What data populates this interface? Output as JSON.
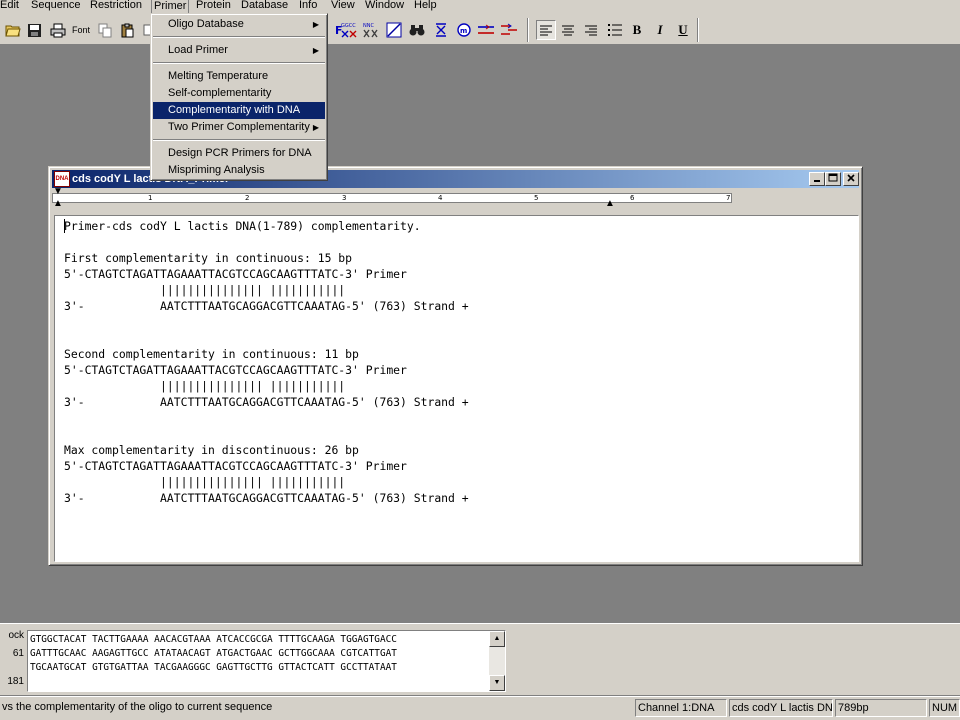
{
  "menubar": {
    "items": [
      "Edit",
      "Sequence",
      "Restriction",
      "Primer",
      "Protein",
      "Database",
      "Info",
      "View",
      "Window",
      "Help"
    ],
    "active": "Primer"
  },
  "toolbar": {
    "font_label": "Font",
    "bold_label": "B",
    "italic_label": "I",
    "underline_label": "U"
  },
  "primer_menu": {
    "items": [
      {
        "label": "Oligo Database",
        "submenu": true
      },
      {
        "label": "Load Primer",
        "submenu": true
      },
      {
        "label": "Melting Temperature",
        "submenu": false
      },
      {
        "label": "Self-complementarity",
        "submenu": false
      },
      {
        "label": "Complementarity with DNA",
        "submenu": false,
        "highlighted": true
      },
      {
        "label": "Two Primer Complementarity",
        "submenu": true
      },
      {
        "label": "Design PCR Primers for DNA",
        "submenu": false
      },
      {
        "label": "Mispriming Analysis",
        "submenu": false
      }
    ]
  },
  "window": {
    "title": "cds codY L lactis DNA_Primer",
    "icon_text": "DNA"
  },
  "ruler": {
    "numbers": [
      "1",
      "2",
      "3",
      "4",
      "5",
      "6",
      "7"
    ]
  },
  "result_text": {
    "heading": "Primer-cds codY L lactis DNA(1-789) complementarity.",
    "sections": [
      {
        "title": "First complementarity in continuous: 15 bp",
        "primer_line": "5'-CTAGTCTAGATTAGAAATTACGTCCAGCAAGTTTATC-3' Primer",
        "match_line": "              ||||||||||||||| |||||||||||",
        "target_line": "3'-           AATCTTTAATGCAGGACGTTCAAATAG-5' (763) Strand +"
      },
      {
        "title": "Second complementarity in continuous: 11 bp",
        "primer_line": "5'-CTAGTCTAGATTAGAAATTACGTCCAGCAAGTTTATC-3' Primer",
        "match_line": "              ||||||||||||||| |||||||||||",
        "target_line": "3'-           AATCTTTAATGCAGGACGTTCAAATAG-5' (763) Strand +"
      },
      {
        "title": "Max complementarity in discontinuous: 26 bp",
        "primer_line": "5'-CTAGTCTAGATTAGAAATTACGTCCAGCAAGTTTATC-3' Primer",
        "match_line": "              ||||||||||||||| |||||||||||",
        "target_line": "3'-           AATCTTTAATGCAGGACGTTCAAATAG-5' (763) Strand +"
      }
    ]
  },
  "sequence_pane": {
    "gutter": [
      "ock",
      "61",
      "181"
    ],
    "lines": [
      "GTGGCTACAT TACTTGAAAA AACACGTAAA ATCACCGCGA TTTTGCAAGA TGGAGTGACC",
      "GATTTGCAAC AAGAGTTGCC ATATAACAGT ATGACTGAAC GCTTGGCAAA CGTCATTGAT",
      "TGCAATGCAT GTGTGATTAA TACGAAGGGC GAGTTGCTTG GTTACTCATT GCCTTATAAT"
    ]
  },
  "statusbar": {
    "message": "vs the complementarity of the oligo to current sequence",
    "channel": "Channel 1:DNA",
    "seq_name": "cds codY L lactis DNA",
    "length": "789bp",
    "num": "NUM"
  }
}
